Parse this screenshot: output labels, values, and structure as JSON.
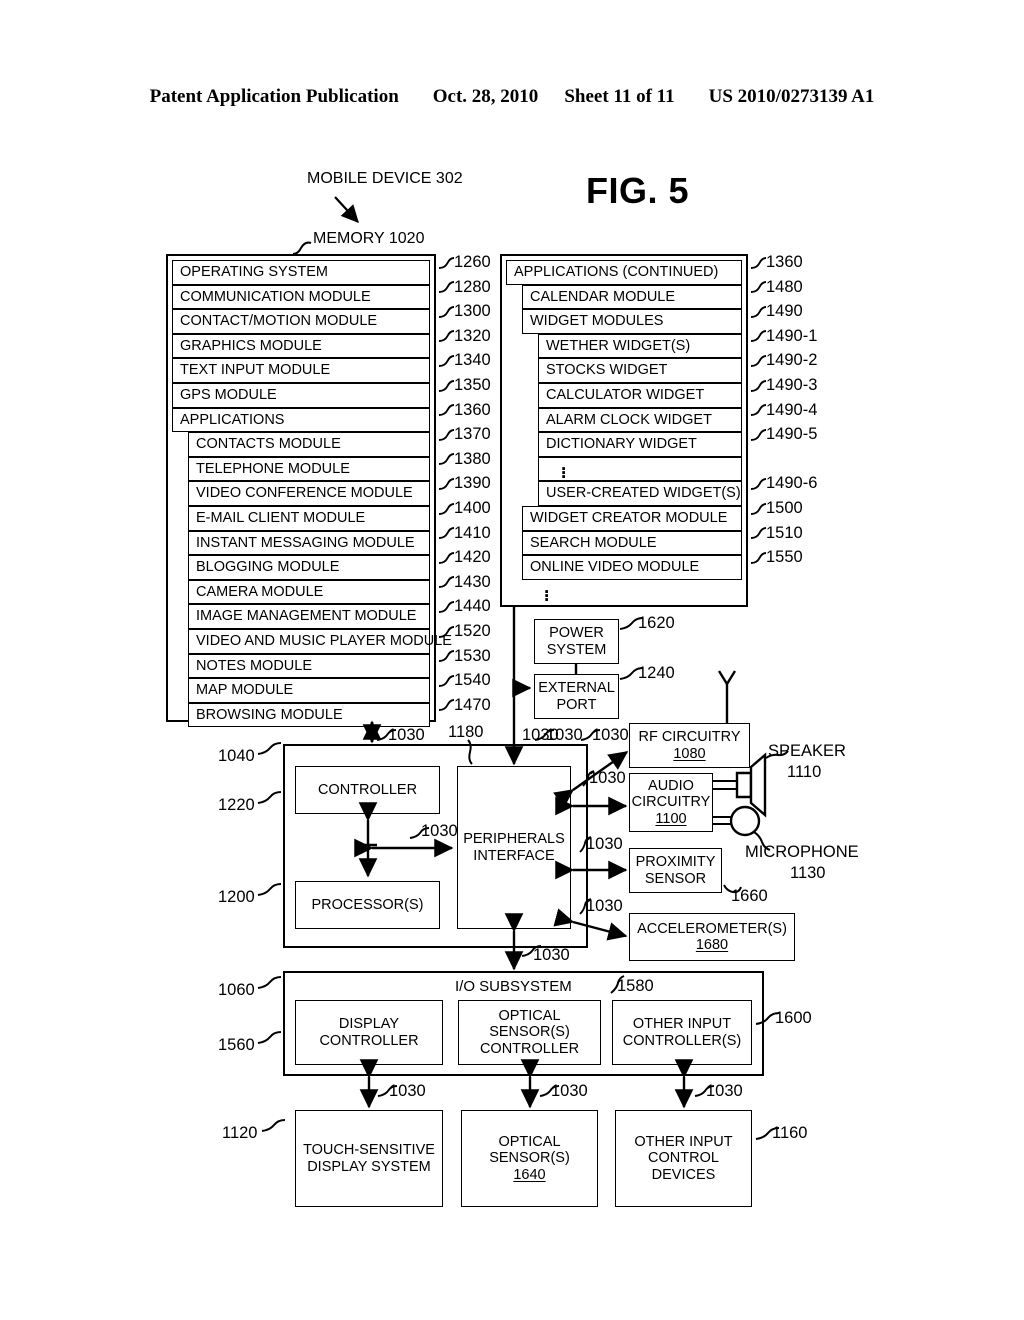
{
  "header": {
    "publication": "Patent Application Publication",
    "date": "Oct. 28, 2010",
    "sheet": "Sheet 11 of 11",
    "number": "US 2010/0273139 A1"
  },
  "figure": {
    "label": "FIG. 5",
    "device_label": "MOBILE DEVICE 302",
    "memory_label": "MEMORY 1020"
  },
  "memory_block": {
    "rows": [
      {
        "label": "OPERATING SYSTEM",
        "ref": "1260",
        "indent": 0
      },
      {
        "label": "COMMUNICATION MODULE",
        "ref": "1280",
        "indent": 0
      },
      {
        "label": "CONTACT/MOTION MODULE",
        "ref": "1300",
        "indent": 0
      },
      {
        "label": "GRAPHICS MODULE",
        "ref": "1320",
        "indent": 0
      },
      {
        "label": "TEXT INPUT MODULE",
        "ref": "1340",
        "indent": 0
      },
      {
        "label": "GPS MODULE",
        "ref": "1350",
        "indent": 0
      },
      {
        "label": "APPLICATIONS",
        "ref": "1360",
        "indent": 0
      },
      {
        "label": "CONTACTS MODULE",
        "ref": "1370",
        "indent": 1
      },
      {
        "label": "TELEPHONE MODULE",
        "ref": "1380",
        "indent": 1
      },
      {
        "label": "VIDEO CONFERENCE MODULE",
        "ref": "1390",
        "indent": 1
      },
      {
        "label": "E-MAIL CLIENT MODULE",
        "ref": "1400",
        "indent": 1
      },
      {
        "label": "INSTANT MESSAGING MODULE",
        "ref": "1410",
        "indent": 1
      },
      {
        "label": "BLOGGING MODULE",
        "ref": "1420",
        "indent": 1
      },
      {
        "label": "CAMERA MODULE",
        "ref": "1430",
        "indent": 1
      },
      {
        "label": "IMAGE MANAGEMENT MODULE",
        "ref": "1440",
        "indent": 1
      },
      {
        "label": "VIDEO AND MUSIC PLAYER MODULE",
        "ref": "1520",
        "indent": 1
      },
      {
        "label": "NOTES MODULE",
        "ref": "1530",
        "indent": 1
      },
      {
        "label": "MAP MODULE",
        "ref": "1540",
        "indent": 1
      },
      {
        "label": "BROWSING MODULE",
        "ref": "1470",
        "indent": 1
      }
    ]
  },
  "applications_block": {
    "title": "APPLICATIONS (CONTINUED)",
    "title_ref": "1360",
    "rows": [
      {
        "label": "CALENDAR MODULE",
        "ref": "1480",
        "indent": 1
      },
      {
        "label": "WIDGET MODULES",
        "ref": "1490",
        "indent": 1
      },
      {
        "label": "WETHER WIDGET(S)",
        "ref": "1490-1",
        "indent": 2
      },
      {
        "label": "STOCKS WIDGET",
        "ref": "1490-2",
        "indent": 2
      },
      {
        "label": "CALCULATOR WIDGET",
        "ref": "1490-3",
        "indent": 2
      },
      {
        "label": "ALARM CLOCK WIDGET",
        "ref": "1490-4",
        "indent": 2
      },
      {
        "label": "DICTIONARY WIDGET",
        "ref": "1490-5",
        "indent": 2
      },
      {
        "label": "",
        "ref": "",
        "indent": 2,
        "ellipsis": true
      },
      {
        "label": "USER-CREATED WIDGET(S)",
        "ref": "1490-6",
        "indent": 2
      },
      {
        "label": "WIDGET CREATOR MODULE",
        "ref": "1500",
        "indent": 1
      },
      {
        "label": "SEARCH MODULE",
        "ref": "1510",
        "indent": 1
      },
      {
        "label": "ONLINE VIDEO MODULE",
        "ref": "1550",
        "indent": 1
      },
      {
        "label": "",
        "ref": "",
        "indent": 1,
        "ellipsis": true
      }
    ]
  },
  "blocks": {
    "power_system": {
      "label": "POWER\nSYSTEM",
      "line1": "POWER",
      "line2": "SYSTEM",
      "ref": "1620"
    },
    "external_port": {
      "line1": "EXTERNAL",
      "line2": "PORT",
      "ref": "1240"
    },
    "rf_circuitry": {
      "line1": "RF CIRCUITRY",
      "ref_inside": "1080"
    },
    "audio_circuitry": {
      "line1": "AUDIO",
      "line2": "CIRCUITRY",
      "ref_inside": "1100"
    },
    "proximity_sensor": {
      "line1": "PROXIMITY",
      "line2": "SENSOR",
      "ref": "1660"
    },
    "accelerometers": {
      "line1": "ACCELEROMETER(S)",
      "ref_inside": "1680"
    },
    "speaker": {
      "label": "SPEAKER",
      "ref": "1110"
    },
    "microphone": {
      "label": "MICROPHONE",
      "ref": "1130"
    },
    "controller": {
      "label": "CONTROLLER",
      "ref": "1220"
    },
    "processors": {
      "label": "PROCESSOR(S)",
      "ref": "1200"
    },
    "peripherals_interface": {
      "line1": "PERIPHERALS",
      "line2": "INTERFACE",
      "ref": "1180"
    },
    "cpu_group": {
      "ref": "1040"
    },
    "io_subsystem": {
      "label": "I/O SUBSYSTEM",
      "ref": "1060"
    },
    "display_controller": {
      "line1": "DISPLAY",
      "line2": "CONTROLLER",
      "ref": "1560"
    },
    "optical_sensor_controller": {
      "line1": "OPTICAL",
      "line2": "SENSOR(S)",
      "line3": "CONTROLLER",
      "ref": "1580"
    },
    "other_input_controller": {
      "line1": "OTHER INPUT",
      "line2": "CONTROLLER(S)",
      "ref": "1600"
    },
    "touch_display": {
      "line1": "TOUCH-SENSITIVE",
      "line2": "DISPLAY SYSTEM",
      "ref": "1120"
    },
    "optical_sensors": {
      "line1": "OPTICAL",
      "line2": "SENSOR(S)",
      "ref_inside": "1640"
    },
    "other_input_devices": {
      "line1": "OTHER INPUT",
      "line2": "CONTROL",
      "line3": "DEVICES",
      "ref": "1160"
    }
  },
  "bus_labels": {
    "b1": "1030",
    "b2": "1030",
    "b3": "1030",
    "b4": "1030",
    "b5": "1030",
    "b6": "1030",
    "b7": "1030",
    "b8": "1030",
    "b9": "1030",
    "b10": "1030",
    "b11": "1030",
    "b12": "1030",
    "b13": "1030",
    "b14": "1030"
  }
}
